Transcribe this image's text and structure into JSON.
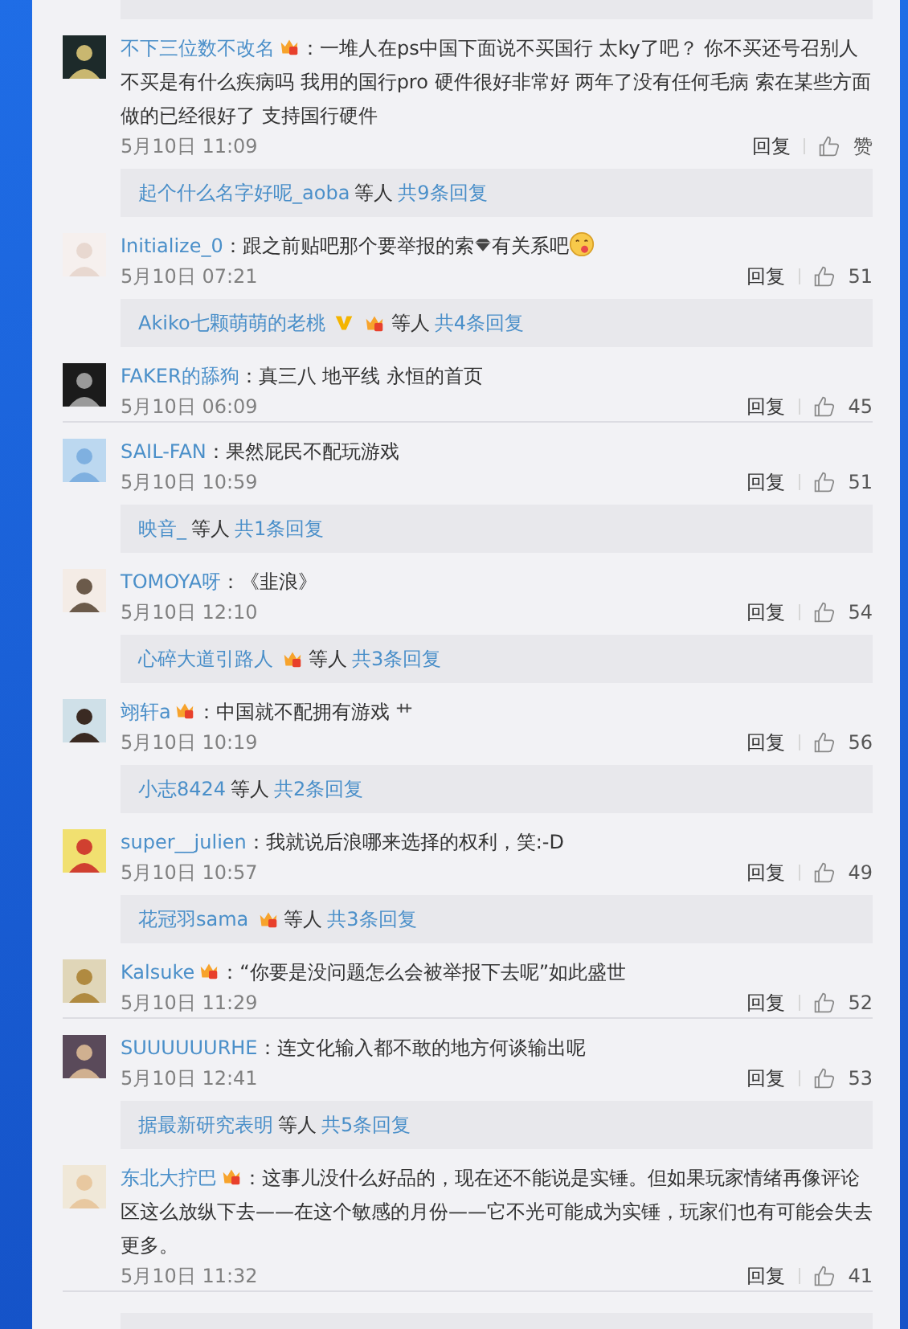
{
  "comments": [
    {
      "user": "不下三位数不改名",
      "badges": [
        {
          "kind": "crown"
        }
      ],
      "parts": [
        {
          "kind": "text",
          "text": "：一堆人在ps中国下面说不买国行 太ky了吧？ 你不买还号召别人不买是有什么疾病吗 我用的国行pro 硬件很好非常好 两年了没有任何毛病 索在某些方面做的已经很好了 支持国行硬件"
        }
      ],
      "time": "5月10日 11:09",
      "reply_label": "回复",
      "likes": "赞",
      "reply": {
        "user": "起个什么名字好呢_aoba",
        "suffix": "等人",
        "count": "共9条回复"
      }
    },
    {
      "user": "Initialize_0",
      "parts": [
        {
          "kind": "text",
          "text": "：跟之前贴吧那个要举报的索"
        },
        {
          "kind": "gem"
        },
        {
          "kind": "text",
          "text": "有关系吧"
        },
        {
          "kind": "smile"
        }
      ],
      "time": "5月10日 07:21",
      "reply_label": "回复",
      "likes": "51",
      "reply": {
        "user": "Akiko七颗萌萌的老桃",
        "badges": [
          {
            "kind": "v"
          },
          {
            "kind": "crown"
          }
        ],
        "suffix": "等人",
        "count": "共4条回复"
      }
    },
    {
      "user": "FAKER的舔狗",
      "parts": [
        {
          "kind": "text",
          "text": "：真三八 地平线 永恒的首页"
        }
      ],
      "time": "5月10日 06:09",
      "reply_label": "回复",
      "likes": "45"
    },
    {
      "user": "SAIL-FAN",
      "parts": [
        {
          "kind": "text",
          "text": "：果然屁民不配玩游戏"
        }
      ],
      "time": "5月10日 10:59",
      "reply_label": "回复",
      "likes": "51",
      "reply": {
        "user": "映音_",
        "suffix": "等人",
        "count": "共1条回复"
      }
    },
    {
      "user": "TOMOYA呀",
      "parts": [
        {
          "kind": "text",
          "text": "：《韭浪》"
        }
      ],
      "time": "5月10日 12:10",
      "reply_label": "回复",
      "likes": "54",
      "reply": {
        "user": "心碎大道引路人",
        "badges": [
          {
            "kind": "crown"
          }
        ],
        "suffix": "等人",
        "count": "共3条回复"
      }
    },
    {
      "user": "翊轩a",
      "badges": [
        {
          "kind": "crown"
        }
      ],
      "parts": [
        {
          "kind": "text",
          "text": "：中国就不配拥有游戏 "
        },
        {
          "kind": "grass"
        }
      ],
      "time": "5月10日 10:19",
      "reply_label": "回复",
      "likes": "56",
      "reply": {
        "user": "小志8424",
        "suffix": "等人",
        "count": "共2条回复"
      }
    },
    {
      "user": "super__julien",
      "parts": [
        {
          "kind": "text",
          "text": "：我就说后浪哪来选择的权利，笑:-D"
        }
      ],
      "time": "5月10日 10:57",
      "reply_label": "回复",
      "likes": "49",
      "reply": {
        "user": "花冠羽sama",
        "badges": [
          {
            "kind": "crown"
          }
        ],
        "suffix": "等人",
        "count": "共3条回复"
      }
    },
    {
      "user": "Kalsuke",
      "badges": [
        {
          "kind": "crown"
        }
      ],
      "parts": [
        {
          "kind": "text",
          "text": "：“你要是没问题怎么会被举报下去呢”如此盛世"
        }
      ],
      "time": "5月10日 11:29",
      "reply_label": "回复",
      "likes": "52"
    },
    {
      "user": "SUUUUUURHE",
      "parts": [
        {
          "kind": "text",
          "text": "：连文化输入都不敢的地方何谈输出呢"
        }
      ],
      "time": "5月10日 12:41",
      "reply_label": "回复",
      "likes": "53",
      "reply": {
        "user": "据最新研究表明",
        "suffix": "等人",
        "count": "共5条回复"
      }
    },
    {
      "user": "东北大拧巴",
      "badges": [
        {
          "kind": "crown"
        }
      ],
      "parts": [
        {
          "kind": "text",
          "text": "：这事儿没什么好品的，现在还不能说是实锤。但如果玩家情绪再像评论区这么放纵下去——在这个敏感的月份——它不光可能成为实锤，玩家们也有可能会失去更多。"
        }
      ],
      "time": "5月10日 11:32",
      "reply_label": "回复",
      "likes": "41"
    }
  ]
}
